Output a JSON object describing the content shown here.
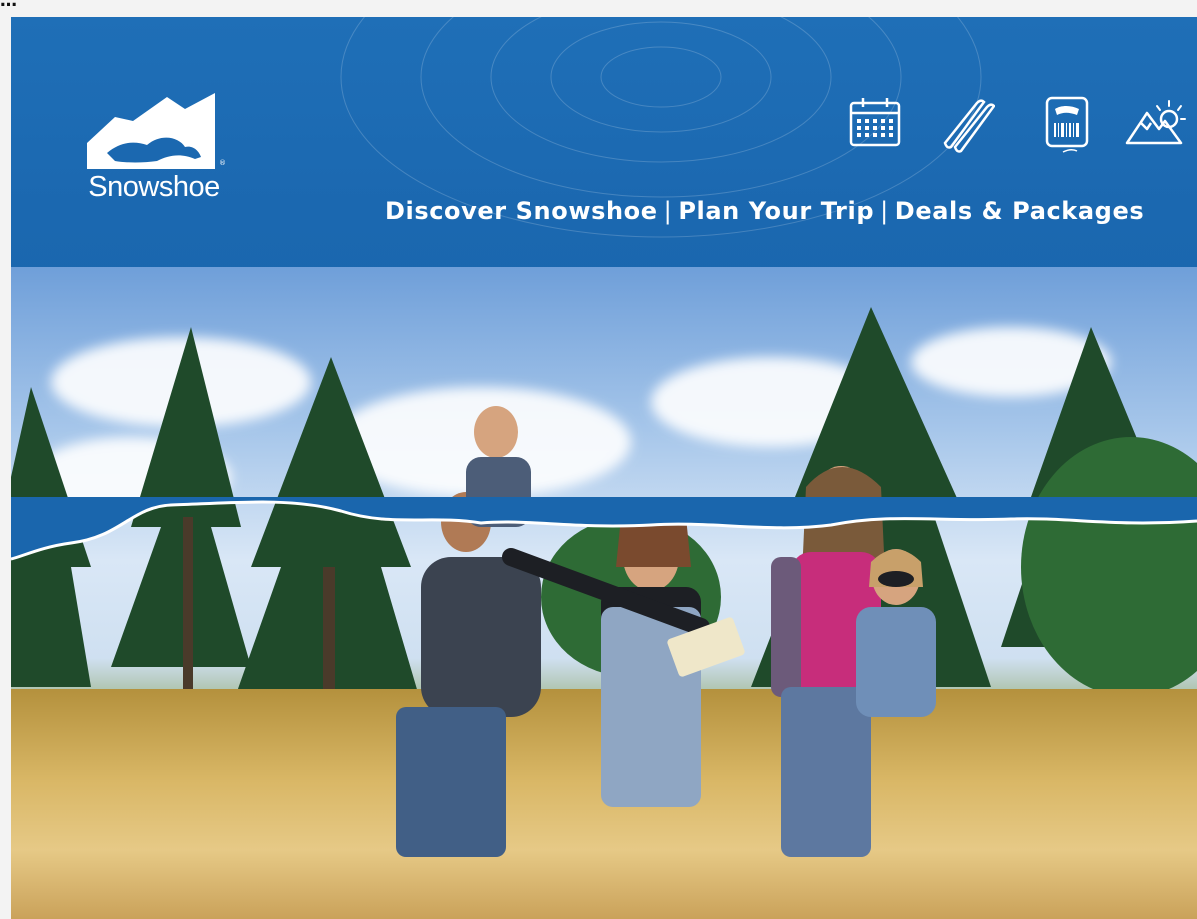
{
  "brand": {
    "name": "Snowshoe"
  },
  "nav": {
    "links": [
      {
        "label": "Discover Snowshoe"
      },
      {
        "label": "Plan Your Trip"
      },
      {
        "label": "Deals & Packages"
      }
    ],
    "separator": "|"
  },
  "header_icons": [
    {
      "icon": "calendar-icon"
    },
    {
      "icon": "skis-icon"
    },
    {
      "icon": "lift-ticket-icon"
    },
    {
      "icon": "mountain-weather-icon"
    }
  ],
  "colors": {
    "header_blue": "#1b68b0",
    "white": "#ffffff"
  }
}
